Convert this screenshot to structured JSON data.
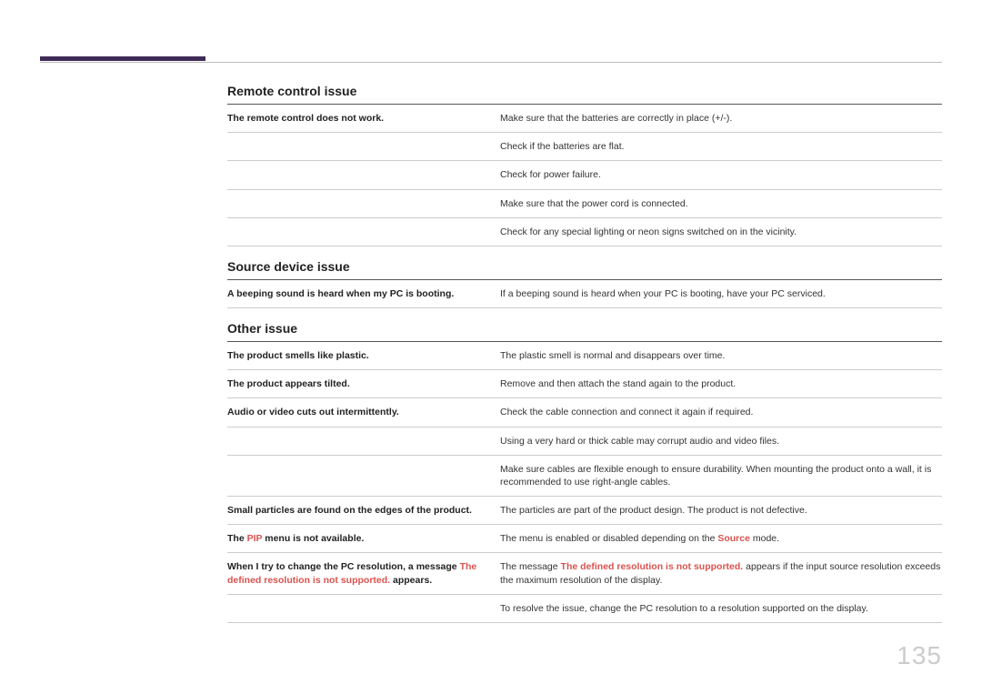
{
  "page_number": "135",
  "sections": [
    {
      "title": "Remote control issue",
      "rows": [
        {
          "issue": [
            {
              "text": "The remote control does not work.",
              "style": "bold"
            }
          ],
          "solutions": [
            [
              {
                "text": "Make sure that the batteries are correctly in place (+/-)."
              }
            ],
            [
              {
                "text": "Check if the batteries are flat."
              }
            ],
            [
              {
                "text": "Check for power failure."
              }
            ],
            [
              {
                "text": "Make sure that the power cord is connected."
              }
            ],
            [
              {
                "text": "Check for any special lighting or neon signs switched on in the vicinity."
              }
            ]
          ]
        }
      ]
    },
    {
      "title": "Source device issue",
      "rows": [
        {
          "issue": [
            {
              "text": "A beeping sound is heard when my PC is booting.",
              "style": "bold"
            }
          ],
          "solutions": [
            [
              {
                "text": "If a beeping sound is heard when your PC is booting, have your PC serviced."
              }
            ]
          ]
        }
      ]
    },
    {
      "title": "Other issue",
      "rows": [
        {
          "issue": [
            {
              "text": "The product smells like plastic.",
              "style": "bold"
            }
          ],
          "solutions": [
            [
              {
                "text": "The plastic smell is normal and disappears over time."
              }
            ]
          ]
        },
        {
          "issue": [
            {
              "text": "The product appears tilted.",
              "style": "bold"
            }
          ],
          "solutions": [
            [
              {
                "text": "Remove and then attach the stand again to the product."
              }
            ]
          ]
        },
        {
          "issue": [
            {
              "text": "Audio or video cuts out intermittently.",
              "style": "bold"
            }
          ],
          "solutions": [
            [
              {
                "text": "Check the cable connection and connect it again if required."
              }
            ],
            [
              {
                "text": "Using a very hard or thick cable may corrupt audio and video files."
              }
            ],
            [
              {
                "text": "Make sure cables are flexible enough to ensure durability. When mounting the product onto a wall, it is recommended to use right-angle cables."
              }
            ]
          ]
        },
        {
          "issue": [
            {
              "text": "Small particles are found on the edges of the product.",
              "style": "bold"
            }
          ],
          "solutions": [
            [
              {
                "text": "The particles are part of the product design. The product is not defective."
              }
            ]
          ]
        },
        {
          "issue": [
            {
              "text": "The ",
              "style": "bold"
            },
            {
              "text": "PIP",
              "style": "red"
            },
            {
              "text": " menu is not available.",
              "style": "bold"
            }
          ],
          "solutions": [
            [
              {
                "text": "The menu is enabled or disabled depending on the "
              },
              {
                "text": "Source",
                "style": "red"
              },
              {
                "text": " mode."
              }
            ]
          ]
        },
        {
          "issue": [
            {
              "text": "When I try to change the PC resolution, a message ",
              "style": "bold"
            },
            {
              "text": "The defined resolution is not supported.",
              "style": "red"
            },
            {
              "text": " appears.",
              "style": "bold"
            }
          ],
          "solutions": [
            [
              {
                "text": "The message "
              },
              {
                "text": "The defined resolution is not supported.",
                "style": "red"
              },
              {
                "text": " appears if the input source resolution exceeds the maximum resolution of the display."
              }
            ],
            [
              {
                "text": "To resolve the issue, change the PC resolution to a resolution supported on the display."
              }
            ]
          ]
        }
      ]
    }
  ]
}
